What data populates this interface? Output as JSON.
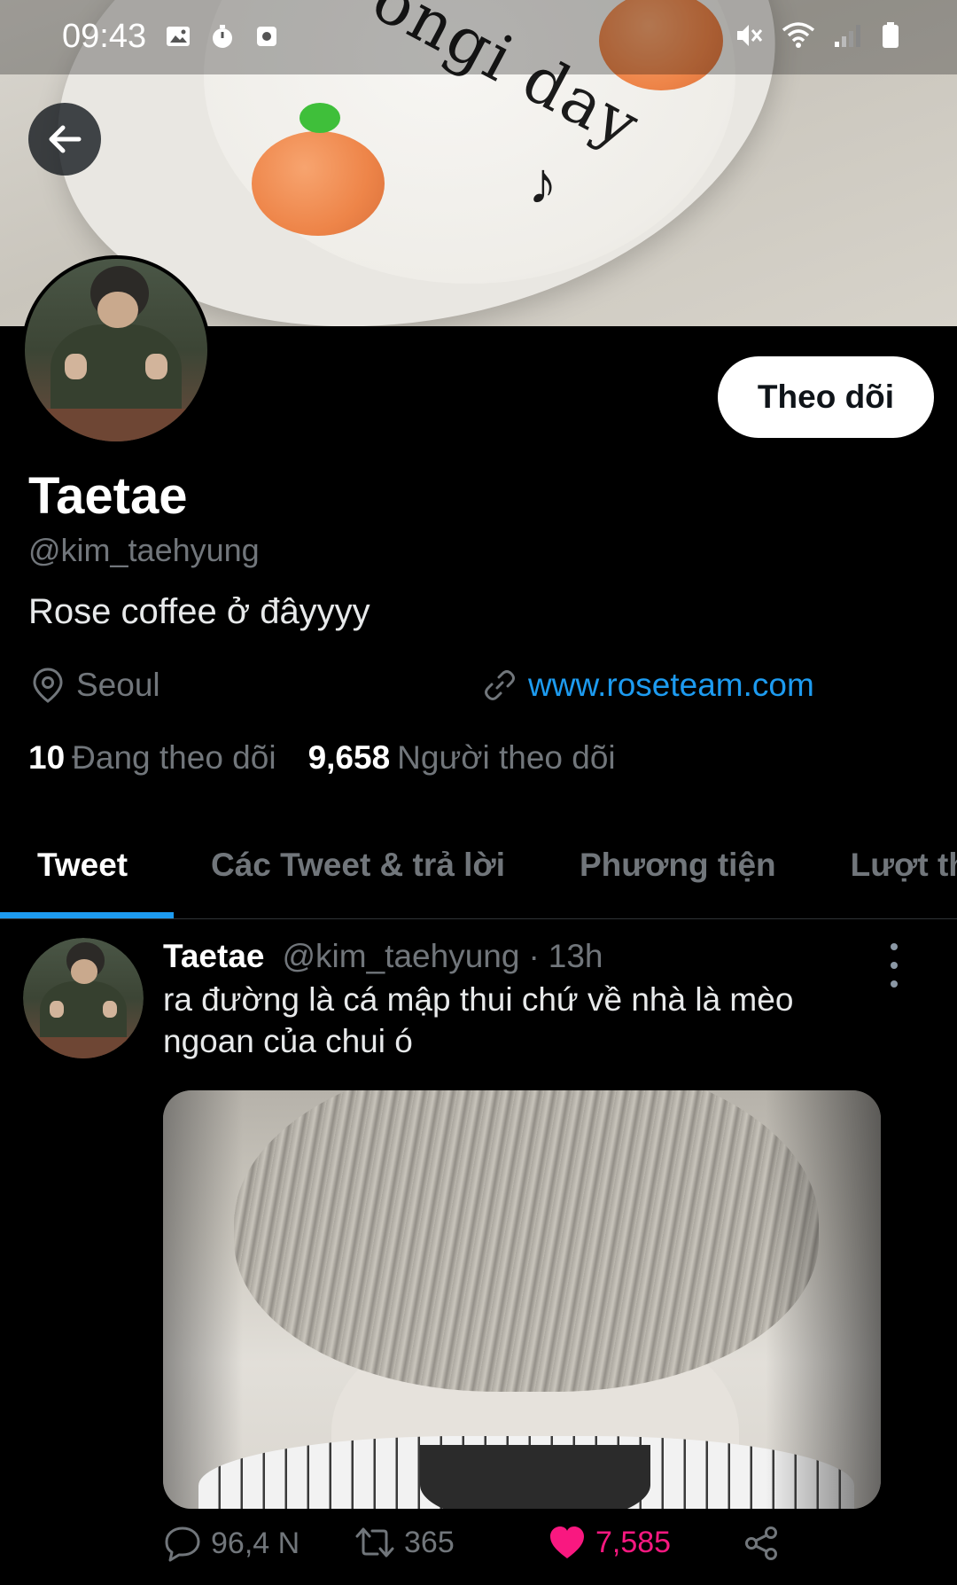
{
  "status_bar": {
    "time": "09:43"
  },
  "profile": {
    "display_name": "Taetae",
    "handle": "@kim_taehyung",
    "bio": "Rose coffee ở đâyyyy",
    "location": "Seoul",
    "website": "www.roseteam.com",
    "following_count": "10",
    "following_label": "Đang theo dõi",
    "followers_count": "9,658",
    "followers_label": "Người theo dõi",
    "follow_button": "Theo dõi"
  },
  "tabs": [
    {
      "label": "Tweet",
      "active": true
    },
    {
      "label": "Các Tweet & trả lời",
      "active": false
    },
    {
      "label": "Phương tiện",
      "active": false
    },
    {
      "label": "Lượt thích",
      "active": false
    }
  ],
  "tweet": {
    "name": "Taetae",
    "handle": "@kim_taehyung",
    "separator": "·",
    "time": "13h",
    "text": "ra đường là cá mập thui chứ về nhà là mèo ngoan của chui ó",
    "replies": "96,4 N",
    "retweets": "365",
    "likes": "7,585"
  },
  "colors": {
    "accent": "#1d9bf0",
    "like": "#f91880",
    "secondary_text": "#71767b"
  },
  "banner": {
    "cake_text": "ongi day"
  },
  "icons": {
    "back": "arrow-left-icon",
    "location": "location-pin-icon",
    "link": "link-icon",
    "reply": "reply-icon",
    "retweet": "retweet-icon",
    "like": "heart-icon",
    "share": "share-icon",
    "menu": "more-vertical-icon"
  }
}
